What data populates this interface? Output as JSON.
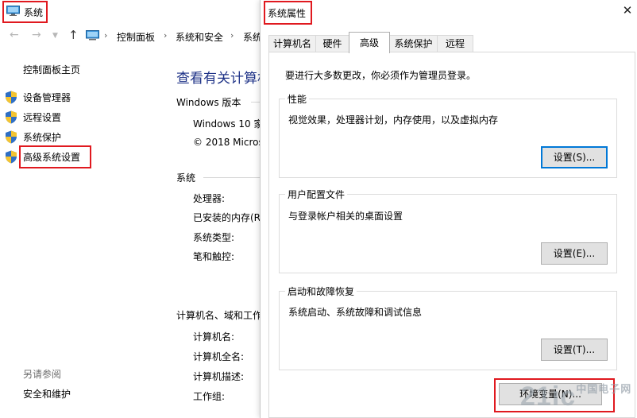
{
  "bg_window": {
    "title": "系统",
    "breadcrumb": [
      "控制面板",
      "系统和安全",
      "系统"
    ],
    "home_link": "控制面板主页",
    "nav_items": [
      "设备管理器",
      "远程设置",
      "系统保护",
      "高级系统设置"
    ],
    "see_also_heading": "另请参阅",
    "see_also_link": "安全和维护",
    "main_title": "查看有关计算机",
    "windows_edition_heading": "Windows 版本",
    "edition_name": "Windows 10 家",
    "copyright": "© 2018 Micros",
    "system_heading": "系统",
    "system_rows": [
      "处理器:",
      "已安装的内存(R",
      "系统类型:",
      "笔和触控:"
    ],
    "computer_heading": "计算机名、域和工作",
    "computer_rows": [
      "计算机名:",
      "计算机全名:",
      "计算机描述:",
      "工作组:"
    ]
  },
  "dialog": {
    "title": "系统属性",
    "close_glyph": "✕",
    "tabs": [
      "计算机名",
      "硬件",
      "高级",
      "系统保护",
      "远程"
    ],
    "active_tab": "高级",
    "admin_note": "要进行大多数更改，你必须作为管理员登录。",
    "groups": [
      {
        "title": "性能",
        "desc": "视觉效果，处理器计划，内存使用，以及虚拟内存",
        "button": "设置(S)..."
      },
      {
        "title": "用户配置文件",
        "desc": "与登录帐户相关的桌面设置",
        "button": "设置(E)..."
      },
      {
        "title": "启动和故障恢复",
        "desc": "系统启动、系统故障和调试信息",
        "button": "设置(T)..."
      }
    ],
    "env_button": "环境变量(N)..."
  },
  "watermark": {
    "main": "21ic",
    "sub": "中国电子网"
  },
  "colors": {
    "highlight": "#e0191f",
    "title_blue": "#1e3287",
    "focus_blue": "#0078d7"
  }
}
